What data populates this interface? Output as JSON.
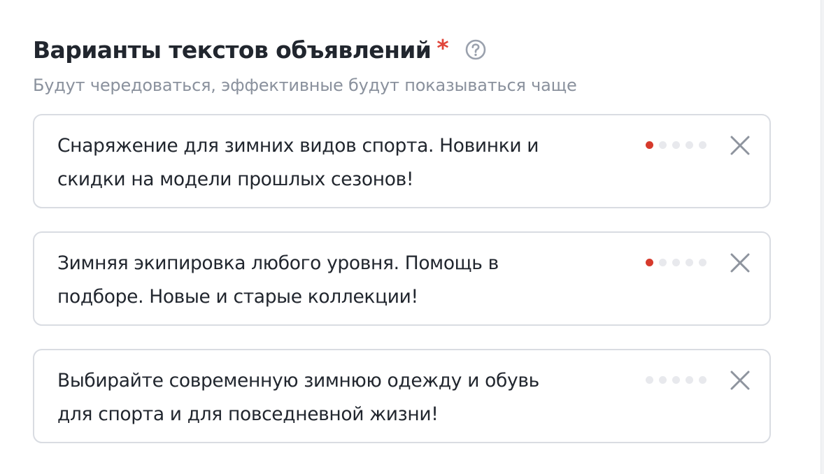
{
  "section": {
    "title": "Варианты текстов объявлений",
    "required_mark": "*",
    "help_icon": "question-circle-icon",
    "subtitle": "Будут чередоваться, эффективные будут показываться чаще"
  },
  "colors": {
    "required": "#e0453a",
    "quality_filled": "#d63a2c",
    "quality_empty": "#e8e9ed",
    "border": "#d9dce2"
  },
  "variants": [
    {
      "line1": "Снаряжение для зимних видов спорта. Новинки и",
      "line2": "скидки на модели прошлых сезонов!",
      "quality_filled": 1,
      "quality_total": 5,
      "remove_icon": "close-icon"
    },
    {
      "line1": "Зимняя экипировка любого уровня. Помощь в",
      "line2": "подборе. Новые и старые коллекции!",
      "quality_filled": 1,
      "quality_total": 5,
      "remove_icon": "close-icon"
    },
    {
      "line1": "Выбирайте современную зимнюю одежду и обувь",
      "line2": "для спорта и для повседневной жизни!",
      "quality_filled": 0,
      "quality_total": 5,
      "remove_icon": "close-icon"
    }
  ]
}
